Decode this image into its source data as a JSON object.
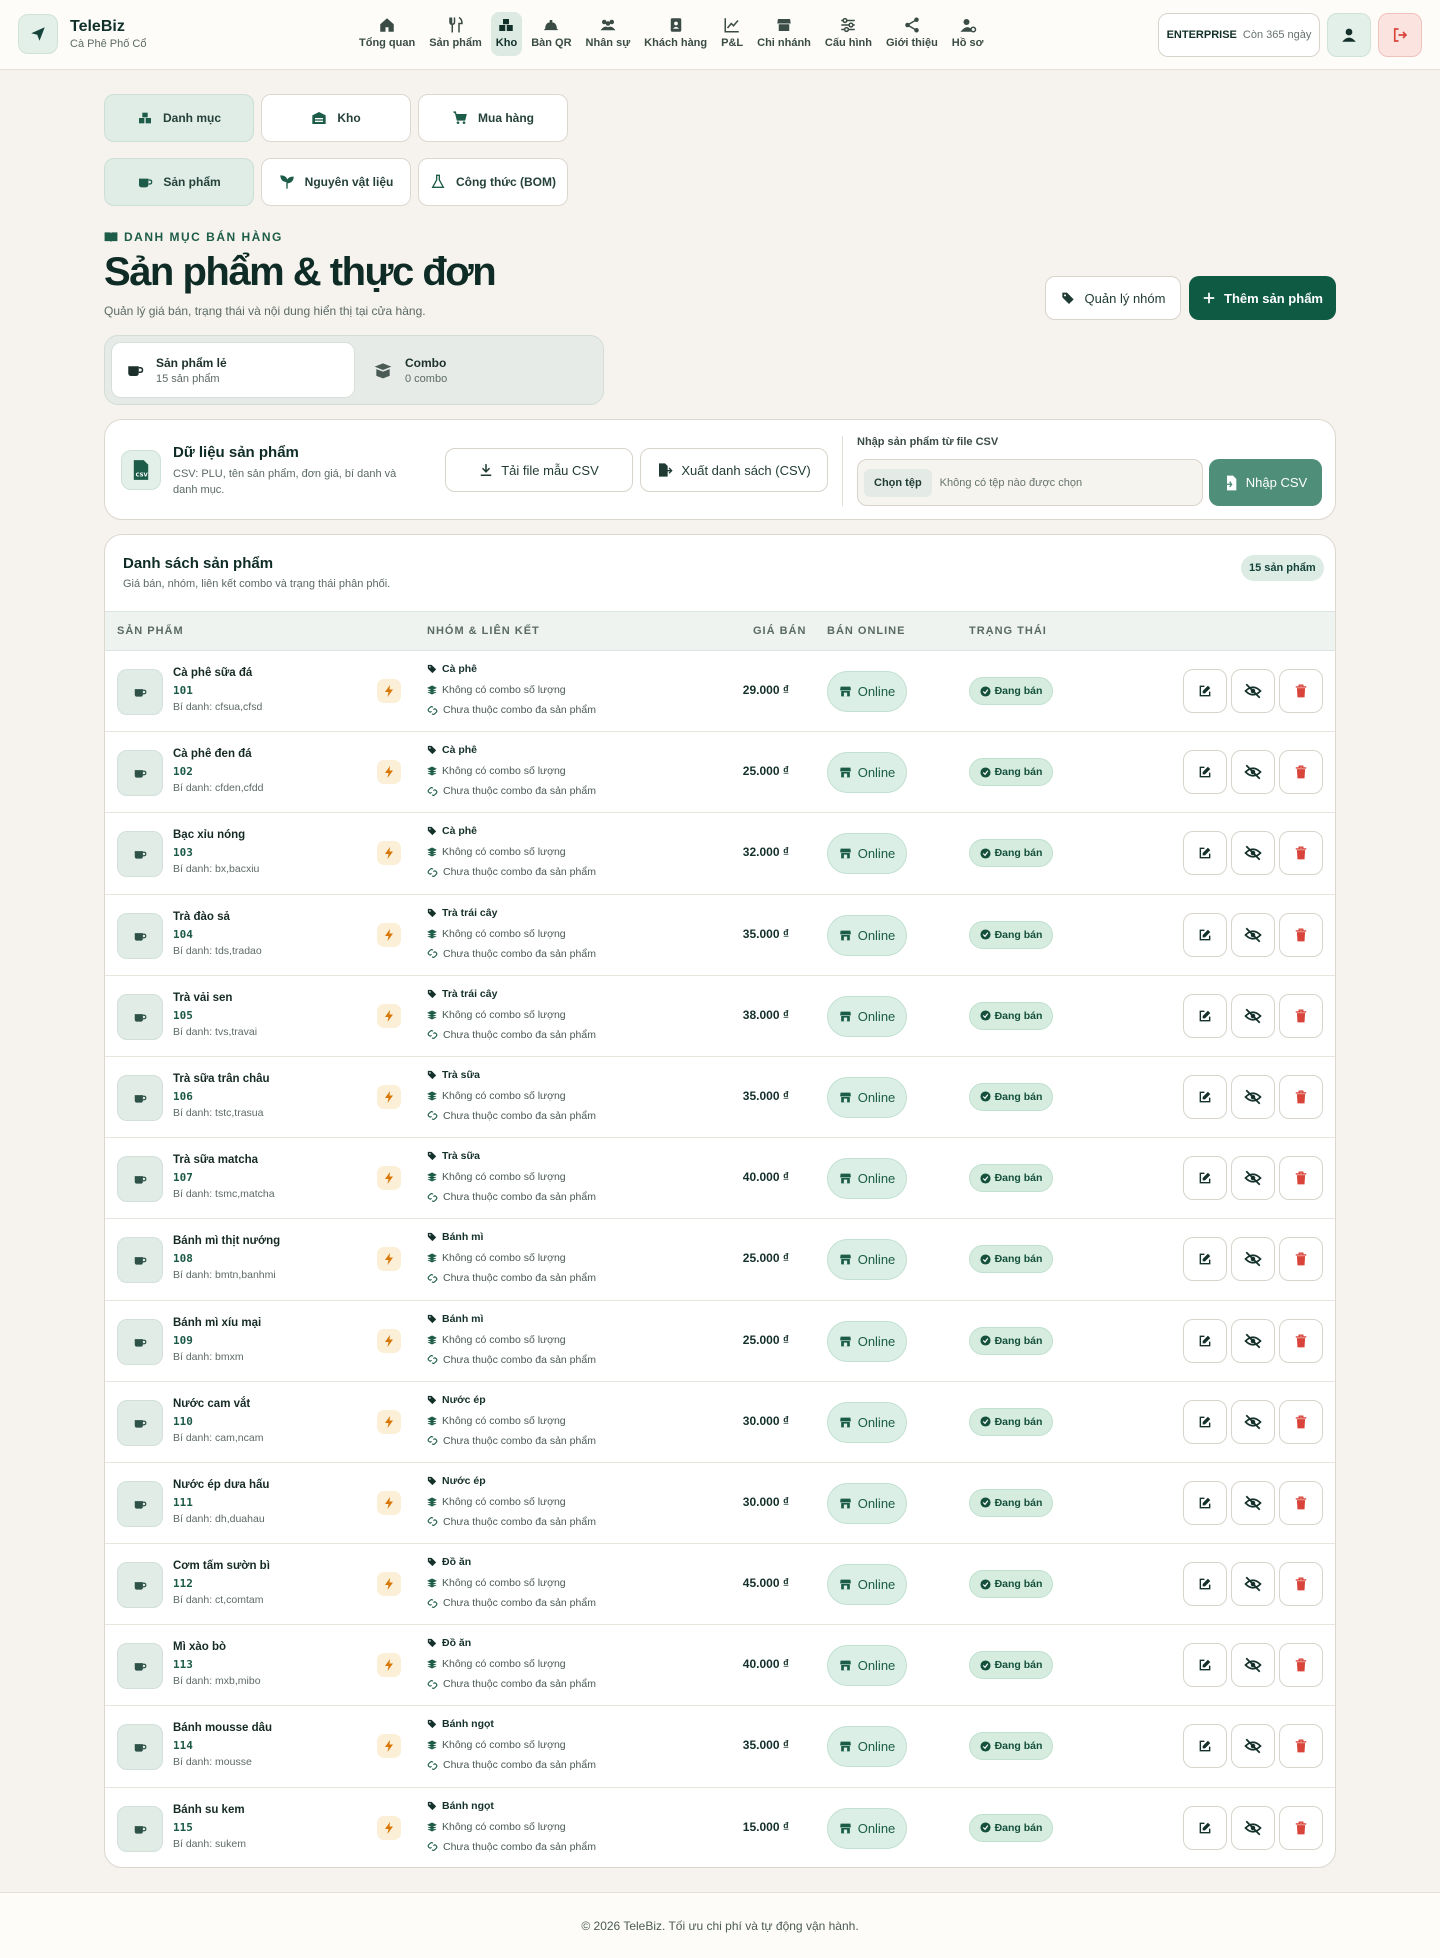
{
  "brand": {
    "name": "TeleBiz",
    "subtitle": "Cà Phê Phố Cổ"
  },
  "nav": [
    {
      "label": "Tổng quan",
      "icon": "home-icon"
    },
    {
      "label": "Sản phẩm",
      "icon": "utensils-icon"
    },
    {
      "label": "Kho",
      "icon": "boxes-icon",
      "active": true
    },
    {
      "label": "Bàn QR",
      "icon": "bell-icon"
    },
    {
      "label": "Nhân sự",
      "icon": "users-icon"
    },
    {
      "label": "Khách hàng",
      "icon": "contacts-icon"
    },
    {
      "label": "P&L",
      "icon": "chart-line-icon"
    },
    {
      "label": "Chi nhánh",
      "icon": "store-icon"
    },
    {
      "label": "Cấu hình",
      "icon": "sliders-icon"
    },
    {
      "label": "Giới thiệu",
      "icon": "share-icon"
    },
    {
      "label": "Hồ sơ",
      "icon": "user-gear-icon"
    }
  ],
  "plan": {
    "tier": "ENTERPRISE",
    "remaining": "Còn 365 ngày"
  },
  "tabs_row1": [
    {
      "label": "Danh mục",
      "active": true
    },
    {
      "label": "Kho",
      "active": false
    },
    {
      "label": "Mua hàng",
      "active": false
    }
  ],
  "tabs_row2": [
    {
      "label": "Sản phẩm",
      "active": true
    },
    {
      "label": "Nguyên vật liệu",
      "active": false
    },
    {
      "label": "Công thức (BOM)",
      "active": false
    }
  ],
  "header": {
    "eyebrow": "DANH MỤC BÁN HÀNG",
    "title": "Sản phẩm & thực đơn",
    "subtitle": "Quản lý giá bán, trạng thái và nội dung hiển thị tại cửa hàng.",
    "group_btn": "Quản lý nhóm",
    "add_btn": "Thêm sản phẩm"
  },
  "segments": [
    {
      "title": "Sản phẩm lẻ",
      "sub": "15 sản phẩm"
    },
    {
      "title": "Combo",
      "sub": "0 combo"
    }
  ],
  "csv": {
    "title": "Dữ liệu sản phẩm",
    "desc": "CSV: PLU, tên sản phẩm, đơn giá, bí danh và danh mục.",
    "template_btn": "Tải file mẫu CSV",
    "export_btn": "Xuất danh sách (CSV)",
    "import_label": "Nhập sản phẩm từ file CSV",
    "choose_btn": "Chọn tệp",
    "no_file": "Không có tệp nào được chọn",
    "import_btn": "Nhập CSV"
  },
  "list": {
    "title": "Danh sách sản phẩm",
    "subtitle": "Giá bán, nhóm, liên kết combo và trạng thái phân phối.",
    "count": "15 sản phẩm",
    "headers": {
      "product": "SẢN PHẨM",
      "group": "NHÓM & LIÊN KẾT",
      "price": "GIÁ BÁN",
      "online": "BÁN ONLINE",
      "status": "TRẠNG THÁI"
    },
    "no_qty_combo": "Không có combo số lượng",
    "no_multi_combo": "Chưa thuộc combo đa sản phẩm",
    "online_label": "Online",
    "status_label": "Đang bán",
    "rows": [
      {
        "name": "Cà phê sữa đá",
        "code": "101",
        "alias": "Bí danh: cfsua,cfsd",
        "group": "Cà phê",
        "price": "29.000 ₫"
      },
      {
        "name": "Cà phê đen đá",
        "code": "102",
        "alias": "Bí danh: cfden,cfdd",
        "group": "Cà phê",
        "price": "25.000 ₫"
      },
      {
        "name": "Bạc xỉu nóng",
        "code": "103",
        "alias": "Bí danh: bx,bacxiu",
        "group": "Cà phê",
        "price": "32.000 ₫"
      },
      {
        "name": "Trà đào sả",
        "code": "104",
        "alias": "Bí danh: tds,tradao",
        "group": "Trà trái cây",
        "price": "35.000 ₫"
      },
      {
        "name": "Trà vải sen",
        "code": "105",
        "alias": "Bí danh: tvs,travai",
        "group": "Trà trái cây",
        "price": "38.000 ₫"
      },
      {
        "name": "Trà sữa trân châu",
        "code": "106",
        "alias": "Bí danh: tstc,trasua",
        "group": "Trà sữa",
        "price": "35.000 ₫"
      },
      {
        "name": "Trà sữa matcha",
        "code": "107",
        "alias": "Bí danh: tsmc,matcha",
        "group": "Trà sữa",
        "price": "40.000 ₫"
      },
      {
        "name": "Bánh mì thịt nướng",
        "code": "108",
        "alias": "Bí danh: bmtn,banhmi",
        "group": "Bánh mì",
        "price": "25.000 ₫"
      },
      {
        "name": "Bánh mì xíu mại",
        "code": "109",
        "alias": "Bí danh: bmxm",
        "group": "Bánh mì",
        "price": "25.000 ₫"
      },
      {
        "name": "Nước cam vắt",
        "code": "110",
        "alias": "Bí danh: cam,ncam",
        "group": "Nước ép",
        "price": "30.000 ₫"
      },
      {
        "name": "Nước ép dưa hấu",
        "code": "111",
        "alias": "Bí danh: dh,duahau",
        "group": "Nước ép",
        "price": "30.000 ₫"
      },
      {
        "name": "Cơm tấm sườn bì",
        "code": "112",
        "alias": "Bí danh: ct,comtam",
        "group": "Đồ ăn",
        "price": "45.000 ₫"
      },
      {
        "name": "Mì xào bò",
        "code": "113",
        "alias": "Bí danh: mxb,mibo",
        "group": "Đồ ăn",
        "price": "40.000 ₫"
      },
      {
        "name": "Bánh mousse dâu",
        "code": "114",
        "alias": "Bí danh: mousse",
        "group": "Bánh ngọt",
        "price": "35.000 ₫"
      },
      {
        "name": "Bánh su kem",
        "code": "115",
        "alias": "Bí danh: sukem",
        "group": "Bánh ngọt",
        "price": "15.000 ₫"
      }
    ]
  },
  "footer": "© 2026 TeleBiz. Tối ưu chi phí và tự động vận hành.",
  "colors": {
    "primary": "#0e5a43",
    "accent_soft": "#dceae3",
    "danger": "#d9443a"
  }
}
